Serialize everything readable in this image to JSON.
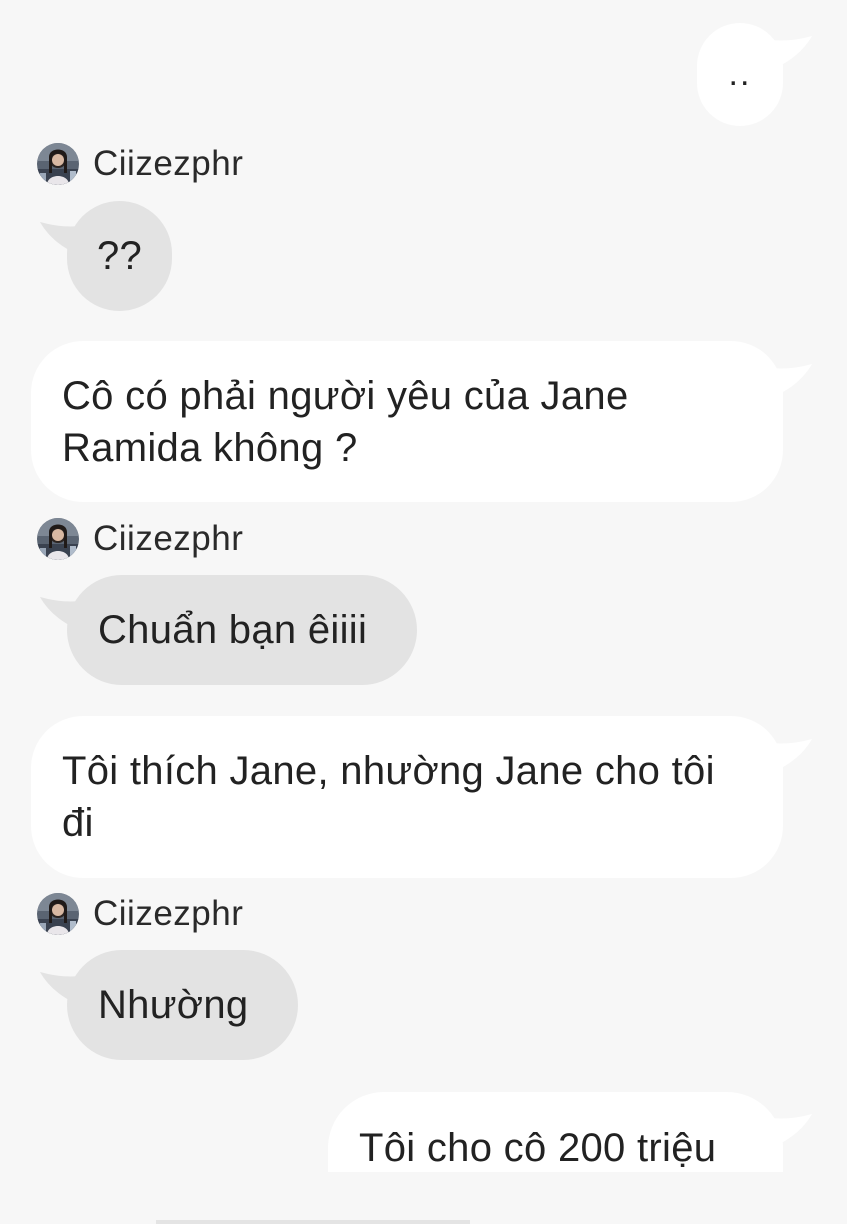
{
  "colors": {
    "background": "#f7f7f7",
    "outgoing_bubble": "#ffffff",
    "incoming_bubble": "#e3e3e3",
    "text": "#222222"
  },
  "messages": [
    {
      "direction": "outgoing",
      "text": ".."
    },
    {
      "direction": "incoming",
      "sender": "Ciizezphr",
      "avatar_icon": "profile-photo-avatar",
      "text": "??"
    },
    {
      "direction": "outgoing",
      "text": "Cô có phải người yêu của Jane Ramida không ?"
    },
    {
      "direction": "incoming",
      "sender": "Ciizezphr",
      "avatar_icon": "profile-photo-avatar",
      "text": "Chuẩn bạn êiiii"
    },
    {
      "direction": "outgoing",
      "text": "Tôi thích Jane, nhường Jane cho tôi đi"
    },
    {
      "direction": "incoming",
      "sender": "Ciizezphr",
      "avatar_icon": "profile-photo-avatar",
      "text": "Nhường"
    },
    {
      "direction": "outgoing",
      "text": "Tôi cho cô 200 triệu"
    }
  ]
}
